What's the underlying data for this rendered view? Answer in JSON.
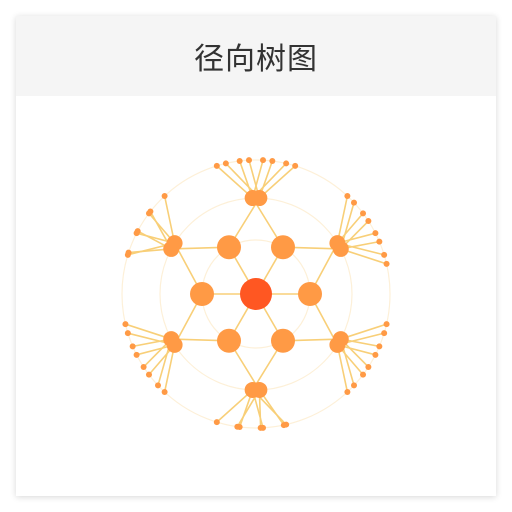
{
  "card": {
    "title": "径向树图"
  },
  "diagram": {
    "type": "radial-tree",
    "colors": {
      "root": "#ff5722",
      "node": "#ff9a45",
      "edge": "#f8cf78",
      "ring": "#fdf0d8"
    },
    "branches": [
      {
        "subgroups": [
          {
            "leaves": 3
          },
          {
            "leaves": 4
          }
        ]
      },
      {
        "subgroups": [
          {
            "leaves": 4
          },
          {
            "leaves": 4
          }
        ]
      },
      {
        "subgroups": [
          {
            "leaves": 4
          },
          {
            "leaves": 4
          }
        ]
      },
      {
        "subgroups": [
          {
            "leaves": 4
          },
          {
            "leaves": 4
          }
        ]
      },
      {
        "subgroups": [
          {
            "leaves": 3
          },
          {
            "leaves": 4
          }
        ]
      },
      {
        "subgroups": [
          {
            "leaves": 4
          },
          {
            "leaves": 4
          }
        ]
      }
    ]
  }
}
